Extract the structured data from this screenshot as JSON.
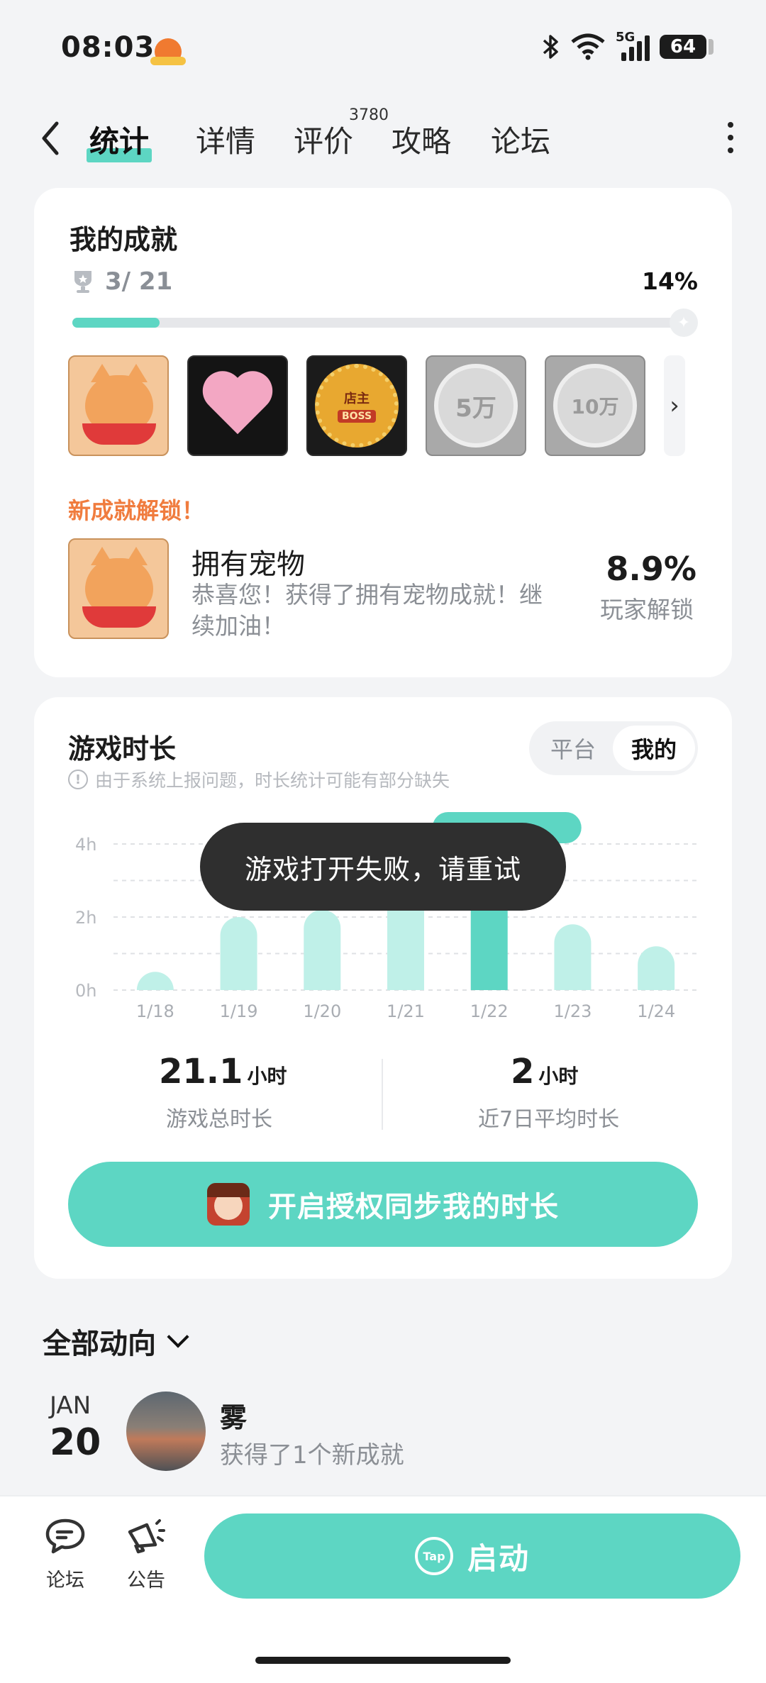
{
  "status": {
    "time": "08:03",
    "network": "5G",
    "battery": "64"
  },
  "nav": {
    "tabs": [
      {
        "label": "统计",
        "active": true
      },
      {
        "label": "详情",
        "active": false
      },
      {
        "label": "评价",
        "active": false
      },
      {
        "label": "攻略",
        "active": false
      },
      {
        "label": "论坛",
        "active": false
      }
    ],
    "review_count": "3780"
  },
  "achievements": {
    "title": "我的成就",
    "progress_text": "3/ 21",
    "percent": "14%",
    "progress_fraction": 0.14,
    "new_title": "新成就解锁！",
    "new_name": "拥有宠物",
    "new_desc": "恭喜您！获得了拥有宠物成就！继续加油！",
    "new_rate": "8.9%",
    "new_rate_label": "玩家解锁",
    "badge_texts": {
      "shop_owner": "店主",
      "boss": "BOSS",
      "coin1": "5万",
      "coin2": "10万"
    }
  },
  "playtime": {
    "title": "游戏时长",
    "toggle": {
      "platform": "平台",
      "mine": "我的"
    },
    "note": "由于系统上报问题，时长统计可能有部分缺失",
    "total_value": "21.1",
    "total_unit": "小时",
    "total_label": "游戏总时长",
    "avg_value": "2",
    "avg_unit": "小时",
    "avg_label": "近7日平均时长",
    "auth_button": "开启授权同步我的时长"
  },
  "chart_data": {
    "type": "bar",
    "categories": [
      "1/18",
      "1/19",
      "1/20",
      "1/21",
      "1/22",
      "1/23",
      "1/24"
    ],
    "values": [
      0.5,
      2.0,
      2.2,
      3.0,
      3.0,
      1.8,
      1.2
    ],
    "y_ticks": [
      "0h",
      "2h",
      "4h"
    ],
    "ylim": [
      0,
      4
    ],
    "highlight_index": 4,
    "grid": true
  },
  "toast": "游戏打开失败，请重试",
  "activity": {
    "title": "全部动向",
    "month": "JAN",
    "day": "20",
    "user": "雾",
    "desc": "获得了1个新成就"
  },
  "bottom": {
    "forum": "论坛",
    "notice": "公告",
    "launch": "启动",
    "tap_logo": "Tap"
  },
  "colors": {
    "accent": "#5dd6c3",
    "orange": "#f07c3e"
  }
}
